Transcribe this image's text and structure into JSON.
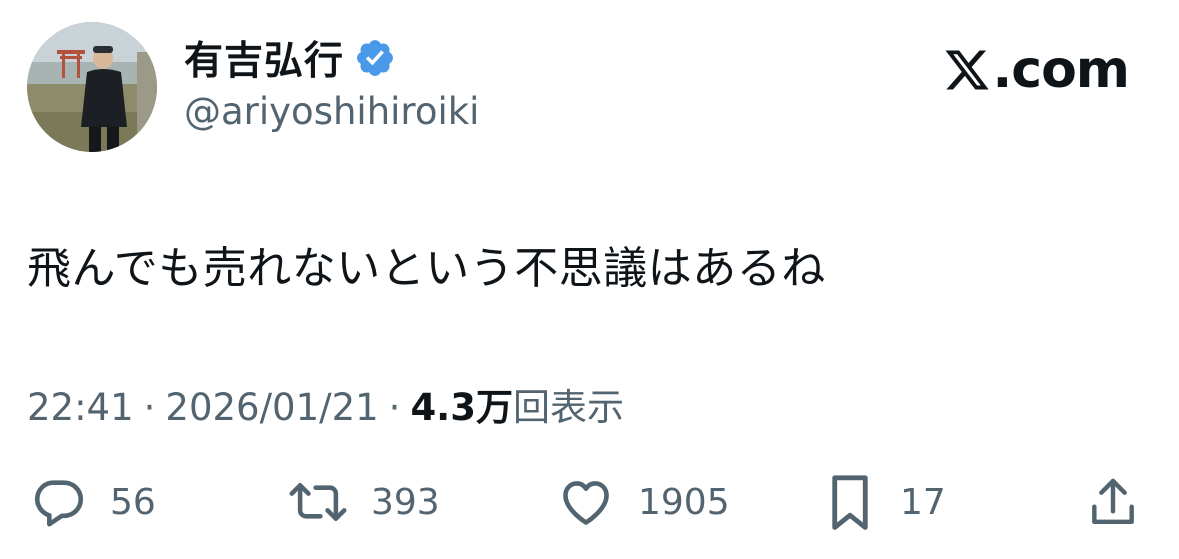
{
  "author": {
    "display_name": "有吉弘行",
    "handle": "@ariyoshihiroiki",
    "verified": true,
    "badge_color": "#4a99e9"
  },
  "source": {
    "brand_text": ".com",
    "logo_icon": "x-logo-icon"
  },
  "tweet": {
    "text": "飛んでも売れないという不思議はあるね"
  },
  "meta": {
    "time": "22:41",
    "separator": "·",
    "date": "2026/01/21",
    "views_count": "4.3万",
    "views_label": "回表示"
  },
  "actions": {
    "reply": {
      "icon": "reply-icon",
      "count": "56"
    },
    "repost": {
      "icon": "repost-icon",
      "count": "393"
    },
    "like": {
      "icon": "heart-icon",
      "count": "1905"
    },
    "bookmark": {
      "icon": "bookmark-icon",
      "count": "17"
    },
    "share": {
      "icon": "share-icon"
    }
  },
  "colors": {
    "text_primary": "#0f1419",
    "text_secondary": "#536471",
    "icon": "#536471"
  }
}
